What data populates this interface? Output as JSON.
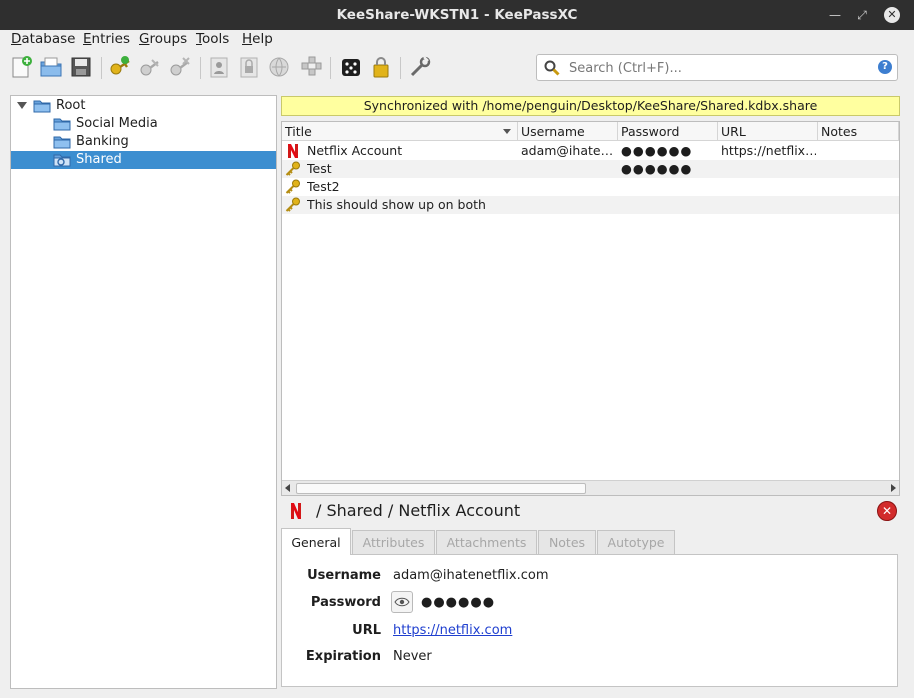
{
  "window": {
    "title": "KeeShare-WKSTN1 - KeePassXC"
  },
  "menu": [
    {
      "prefix": "",
      "key": "D",
      "rest": "atabase"
    },
    {
      "prefix": "",
      "key": "E",
      "rest": "ntries"
    },
    {
      "prefix": "",
      "key": "G",
      "rest": "roups"
    },
    {
      "prefix": "",
      "key": "T",
      "rest": "ools"
    },
    {
      "prefix": "",
      "key": "H",
      "rest": "elp"
    }
  ],
  "search": {
    "placeholder": "Search (Ctrl+F)...",
    "help": "?"
  },
  "groups": {
    "items": [
      {
        "label": "Root"
      },
      {
        "label": "Social Media"
      },
      {
        "label": "Banking"
      },
      {
        "label": "Shared"
      }
    ]
  },
  "banner": {
    "text": "Synchronized with /home/penguin/Desktop/KeeShare/Shared.kdbx.share"
  },
  "entries": {
    "columns": [
      "Title",
      "Username",
      "Password",
      "URL",
      "Notes"
    ],
    "rows": [
      {
        "title": "Netflix Account",
        "username": "adam@ihate…",
        "password": "●●●●●●",
        "url": "https://netflix…",
        "notes": "",
        "icon": "netflix-icon"
      },
      {
        "title": "Test",
        "username": "",
        "password": "●●●●●●",
        "url": "",
        "notes": "",
        "icon": "key-icon"
      },
      {
        "title": "Test2",
        "username": "",
        "password": "",
        "url": "",
        "notes": "",
        "icon": "key-icon"
      },
      {
        "title": "This should show up on both",
        "username": "",
        "password": "",
        "url": "",
        "notes": "",
        "icon": "key-icon"
      }
    ]
  },
  "preview": {
    "title": "/ Shared / Netflix Account",
    "tabs": [
      "General",
      "Attributes",
      "Attachments",
      "Notes",
      "Autotype"
    ],
    "fields": {
      "username_label": "Username",
      "username": "adam@ihatenetflix.com",
      "password_label": "Password",
      "password": "●●●●●●",
      "url_label": "URL",
      "url": "https://netflix.com",
      "expiration_label": "Expiration",
      "expiration": "Never"
    }
  },
  "colors": {
    "selection": "#3c8ed0",
    "banner": "#ffff9f",
    "link": "#1f3fcf",
    "close": "#d22c2c"
  }
}
